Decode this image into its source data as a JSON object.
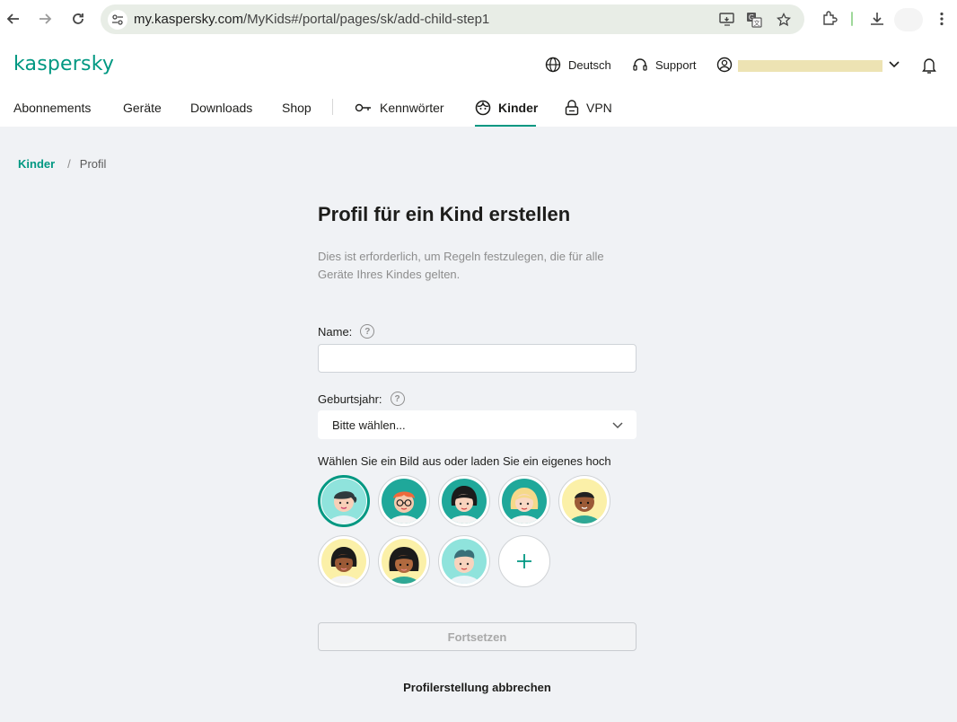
{
  "browser": {
    "url_host": "my.kaspersky.com",
    "url_path": "/MyKids#/portal/pages/sk/add-child-step1"
  },
  "header": {
    "logo": "kaspersky",
    "language": "Deutsch",
    "support": "Support"
  },
  "tabs": [
    {
      "label": "Abonnements"
    },
    {
      "label": "Geräte"
    },
    {
      "label": "Downloads"
    },
    {
      "label": "Shop"
    },
    {
      "label": "Kennwörter"
    },
    {
      "label": "Kinder"
    },
    {
      "label": "VPN"
    }
  ],
  "breadcrumb": {
    "parent": "Kinder",
    "separator": "/",
    "current": "Profil"
  },
  "form": {
    "title": "Profil für ein Kind erstellen",
    "subtitle": "Dies ist erforderlich, um Regeln festzulegen, die für alle Geräte Ihres Kindes gelten.",
    "name_label": "Name:",
    "name_value": "",
    "birth_label": "Geburtsjahr:",
    "birth_value": "Bitte wählen...",
    "avatar_label": "Wählen Sie ein Bild aus oder laden Sie ein eigenes hoch",
    "continue_label": "Fortsetzen",
    "cancel_label": "Profilerstellung abbrechen"
  },
  "colors": {
    "brand": "#009882",
    "background": "#f0f2f5"
  }
}
